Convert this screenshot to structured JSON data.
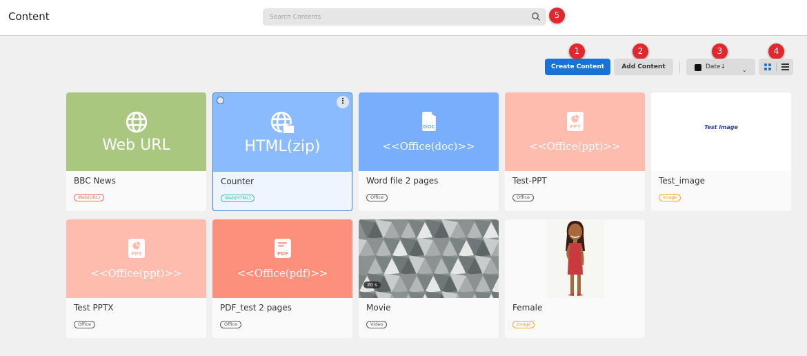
{
  "header": {
    "title": "Content",
    "search_placeholder": "Search Contents"
  },
  "toolbar": {
    "create_label": "Create Content",
    "add_label": "Add Content",
    "sort_label": "Date↓"
  },
  "badges": [
    "1",
    "2",
    "3",
    "4",
    "5"
  ],
  "colors": {
    "accent": "#1a73d4",
    "badge": "#e0282e"
  },
  "cards": [
    {
      "name": "BBC News",
      "tag": "Web(URL)",
      "tag_color": "#f07070",
      "thumb_bg": "#a9c77f",
      "thumb_text": "Web URL",
      "icon": "globe-icon",
      "style": "sans"
    },
    {
      "name": "Counter",
      "tag": "Web(HTML)",
      "tag_color": "#3cbf9f",
      "thumb_bg": "#8bbbff",
      "thumb_text": "HTML(zip)",
      "icon": "globe-folder-icon",
      "style": "sans",
      "selected": true
    },
    {
      "name": "Word file 2 pages",
      "tag": "Office",
      "tag_color": "#555555",
      "thumb_bg": "#78aefc",
      "thumb_text": "<<Office(doc)>>",
      "icon": "doc-file-icon",
      "icon_label": "DOC",
      "style": "serif"
    },
    {
      "name": "Test-PPT",
      "tag": "Office",
      "tag_color": "#555555",
      "thumb_bg": "#fdbcad",
      "thumb_text": "<<Office(ppt)>>",
      "icon": "ppt-file-icon",
      "icon_label": "PPT",
      "style": "serif"
    },
    {
      "name": "Test_image",
      "tag": "Image",
      "tag_color": "#f5a623",
      "thumb_bg": "#ffffff",
      "thumb_text": "Test image",
      "icon": "image-thumbnail",
      "style": "image"
    },
    {
      "name": "Test PPTX",
      "tag": "Office",
      "tag_color": "#555555",
      "thumb_bg": "#fdbcad",
      "thumb_text": "<<Office(ppt)>>",
      "icon": "ppt-file-icon",
      "icon_label": "PPT",
      "style": "serif"
    },
    {
      "name": "PDF_test 2 pages",
      "tag": "Office",
      "tag_color": "#555555",
      "thumb_bg": "#fd907c",
      "thumb_text": "<<Office(pdf)>>",
      "icon": "pdf-file-icon",
      "icon_label": "PDF",
      "style": "serif"
    },
    {
      "name": "Movie",
      "tag": "Video",
      "tag_color": "#555555",
      "thumb_bg": "#8a8f90",
      "duration": "20 s",
      "icon": "video-thumbnail",
      "style": "video"
    },
    {
      "name": "Female",
      "tag": "Image",
      "tag_color": "#f5a623",
      "thumb_bg": "#fafafa",
      "icon": "female-illustration",
      "style": "female"
    }
  ]
}
